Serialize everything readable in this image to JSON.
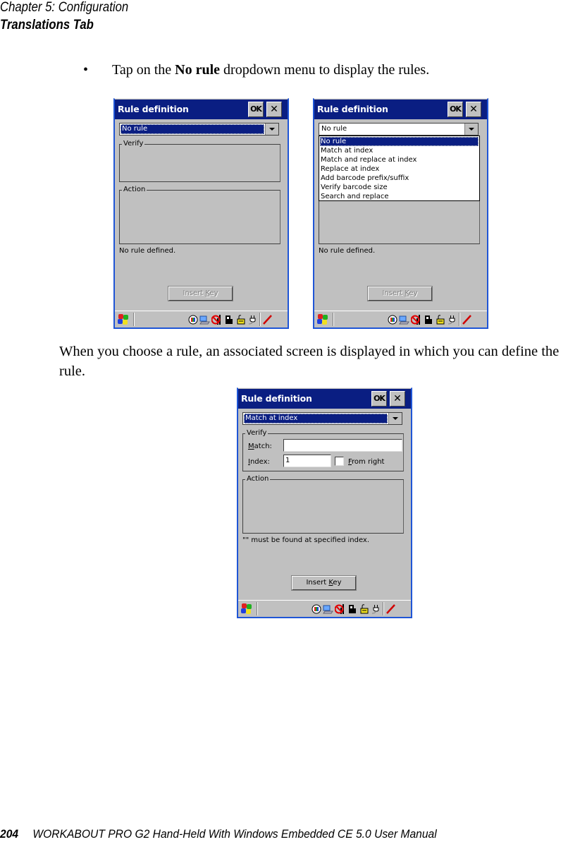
{
  "header": {
    "chapter": "Chapter  5:  Configuration",
    "section": "Translations Tab"
  },
  "body": {
    "bullet_symbol": "•",
    "bullet_prefix": "Tap on the ",
    "bullet_bold": "No rule",
    "bullet_suffix": " dropdown menu to display the rules.",
    "paragraph": "When you choose a rule, an associated screen is displayed in which you can define the rule."
  },
  "screens": [
    {
      "title": "Rule definition",
      "ok_label": "OK",
      "close_label": "✕",
      "rule_select": "No rule",
      "verify_label": "Verify",
      "action_label": "Action",
      "status": "No rule defined.",
      "insert_key_prefix": "Insert ",
      "insert_key_underlined": "K",
      "insert_key_suffix": "ey",
      "insert_key_enabled": false
    },
    {
      "title": "Rule definition",
      "ok_label": "OK",
      "close_label": "✕",
      "rule_select": "No rule",
      "dropdown_options": [
        "No rule",
        "Match at index",
        "Match and replace at index",
        "Replace at index",
        "Add barcode prefix/suffix",
        "Verify barcode size",
        "Search and replace"
      ],
      "dropdown_selected_index": 0,
      "status": "No rule defined.",
      "insert_key_prefix": "Insert ",
      "insert_key_underlined": "K",
      "insert_key_suffix": "ey",
      "insert_key_enabled": false
    },
    {
      "title": "Rule definition",
      "ok_label": "OK",
      "close_label": "✕",
      "rule_select": "Match at index",
      "verify_label": "Verify",
      "match_label_u": "M",
      "match_label_rest": "atch:",
      "match_value": "",
      "index_label_u": "I",
      "index_label_rest": "ndex:",
      "index_value": "1",
      "from_right_u": "F",
      "from_right_rest": "rom right",
      "from_right_checked": false,
      "action_label": "Action",
      "status": "\"\" must be found at specified index.",
      "insert_key_prefix": "Insert ",
      "insert_key_underlined": "K",
      "insert_key_suffix": "ey",
      "insert_key_enabled": true
    }
  ],
  "taskbar": {
    "icons": [
      "start-icon",
      "network-icon",
      "pc-connection-icon",
      "no-signal-icon",
      "scanner-icon",
      "lock-icon",
      "power-plug-icon",
      "pen-input-icon"
    ]
  },
  "footer": {
    "page_number": "204",
    "manual_title": "WORKABOUT PRO G2 Hand-Held With Windows Embedded CE 5.0 User Manual"
  }
}
